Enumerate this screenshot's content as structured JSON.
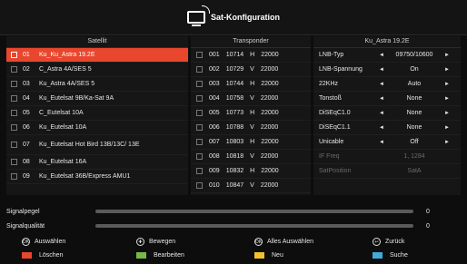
{
  "title": "Sat-Konfiguration",
  "satellite": {
    "header": "Satellit",
    "items": [
      {
        "num": "01",
        "name": "Ku_Ku_Astra 19.2E",
        "selected": true
      },
      {
        "num": "02",
        "name": "C_Astra 4A/SES 5",
        "selected": false
      },
      {
        "num": "03",
        "name": "Ku_Astra 4A/SES 5",
        "selected": false
      },
      {
        "num": "04",
        "name": "Ku_Eutelsat 9B/Ka-Sat 9A",
        "selected": false
      },
      {
        "num": "05",
        "name": "C_Eutelsat 10A",
        "selected": false
      },
      {
        "num": "06",
        "name": "Ku_Eutelsat 10A",
        "selected": false
      },
      {
        "num": "07",
        "name": "Ku_Eutelsat Hot Bird 13B/13C/ 13E",
        "selected": false
      },
      {
        "num": "08",
        "name": "Ku_Eutelsat 16A",
        "selected": false
      },
      {
        "num": "09",
        "name": "Ku_Eutelsat 36B/Express AMU1",
        "selected": false
      }
    ]
  },
  "transponder": {
    "header": "Transponder",
    "items": [
      {
        "num": "001",
        "freq": "10714",
        "pol": "H",
        "sr": "22000"
      },
      {
        "num": "002",
        "freq": "10729",
        "pol": "V",
        "sr": "22000"
      },
      {
        "num": "003",
        "freq": "10744",
        "pol": "H",
        "sr": "22000"
      },
      {
        "num": "004",
        "freq": "10758",
        "pol": "V",
        "sr": "22000"
      },
      {
        "num": "005",
        "freq": "10773",
        "pol": "H",
        "sr": "22000"
      },
      {
        "num": "006",
        "freq": "10788",
        "pol": "V",
        "sr": "22000"
      },
      {
        "num": "007",
        "freq": "10803",
        "pol": "H",
        "sr": "22000"
      },
      {
        "num": "008",
        "freq": "10818",
        "pol": "V",
        "sr": "22000"
      },
      {
        "num": "009",
        "freq": "10832",
        "pol": "H",
        "sr": "22000"
      },
      {
        "num": "010",
        "freq": "10847",
        "pol": "V",
        "sr": "22000"
      }
    ]
  },
  "lnb": {
    "header": "Ku_Astra 19.2E",
    "settings": [
      {
        "label": "LNB-Typ",
        "value": "09750/10600",
        "arrows": true
      },
      {
        "label": "LNB-Spannung",
        "value": "On",
        "arrows": true
      },
      {
        "label": "22KHz",
        "value": "Auto",
        "arrows": true
      },
      {
        "label": "Tonstoß",
        "value": "None",
        "arrows": true
      },
      {
        "label": "DiSEqC1.0",
        "value": "None",
        "arrows": true
      },
      {
        "label": "DiSEqC1.1",
        "value": "None",
        "arrows": true
      },
      {
        "label": "Unicable",
        "value": "Off",
        "arrows": true
      },
      {
        "label": "IF Freq",
        "value": "1, 1284",
        "arrows": false
      },
      {
        "label": "SatPosition",
        "value": "SatA",
        "arrows": false
      }
    ]
  },
  "signal": {
    "level_label": "Signalpegel",
    "level_value": "0",
    "quality_label": "Signalqualität",
    "quality_value": "0"
  },
  "hints": {
    "select": "Auswählen",
    "move": "Bewegen",
    "select_all": "Alles Auswählen",
    "back": "Zurück"
  },
  "color_buttons": {
    "red": "Löschen",
    "green": "Bearbeiten",
    "yellow": "Neu",
    "blue": "Suche"
  },
  "colors": {
    "selected": "#e8462d",
    "red": "#e8462d",
    "green": "#77b947",
    "yellow": "#f2c12e",
    "blue": "#3fa9d9"
  }
}
